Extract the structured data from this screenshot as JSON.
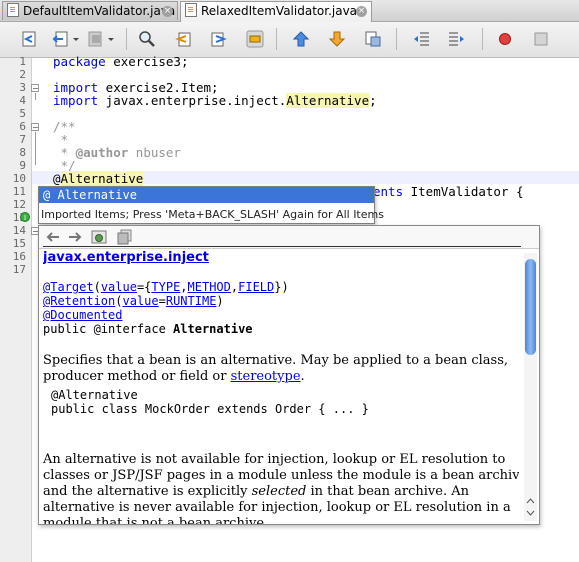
{
  "tabs": [
    {
      "label": "DefaultItemValidator.java",
      "active": false
    },
    {
      "label": "RelaxedItemValidator.java",
      "active": true
    }
  ],
  "toolbar_icons": [
    "last-edit-icon",
    "back-icon",
    "forward-icon",
    "find-icon",
    "find-previous-icon",
    "find-next-icon",
    "toggle-highlight-icon",
    "previous-bookmark-icon",
    "next-bookmark-icon",
    "toggle-bookmark-icon",
    "shift-left-icon",
    "shift-right-icon",
    "start-macro-icon",
    "stop-macro-icon"
  ],
  "line_numbers": [
    "1",
    "2",
    "3",
    "4",
    "5",
    "6",
    "7",
    "8",
    "9",
    "10",
    "11",
    "12",
    "13",
    "14",
    "15",
    "16",
    "17"
  ],
  "code": {
    "l1_kw": "package",
    "l1_rest": " exercise3;",
    "l3_kw": "import",
    "l3_rest": " exercise2.Item;",
    "l4_kw": "import",
    "l4_pre": " javax.enterprise.inject.",
    "l4_hl": "Alternative",
    "l4_post": ";",
    "l6": "/**",
    "l7": " *",
    "l8_pre": " * ",
    "l8_tag": "@author",
    "l8_post": " nbuser",
    "l9": " */",
    "l10_at": "@",
    "l10_name": "Alternative",
    "l11_tail_kw": "ents",
    "l11_tail": " ItemValidator {"
  },
  "completion": {
    "item": "@ Alternative",
    "hint": "Imported Items; Press 'Meta+BACK_SLASH' Again for All Items"
  },
  "doc": {
    "package": "javax.enterprise.inject",
    "anno_target": "@Target",
    "target_open": "(",
    "value_kw": "value",
    "target_eq": "={",
    "type": "TYPE",
    "method": "METHOD",
    "field": "FIELD",
    "target_close": "})",
    "anno_retention": "@Retention",
    "ret_open": "(",
    "value_kw2": "value",
    "ret_eq": "=",
    "runtime": "RUNTIME",
    "ret_close": ")",
    "anno_documented": "@Documented",
    "decl_pre": "public @interface ",
    "decl_name": "Alternative",
    "para1_line1": "Specifies that a bean is an alternative. May be applied to a bean class,",
    "para1_line2_pre": "producer method or field or ",
    "para1_link": "stereotype",
    "para1_line2_post": ".",
    "example1": "@Alternative",
    "example2": "public class MockOrder extends Order { ... }",
    "para2_line1": "An alternative is not available for injection, lookup or EL resolution to",
    "para2_line2": "classes or JSP/JSF pages in a module unless the module is a bean archive",
    "para2_line3_pre": "and the alternative is explicitly ",
    "para2_line3_em": "selected",
    "para2_line3_post": " in that bean archive. An",
    "para2_line4": "alternative is never available for injection, lookup or EL resolution in a",
    "para2_line5": "module that is not a bean archive."
  }
}
